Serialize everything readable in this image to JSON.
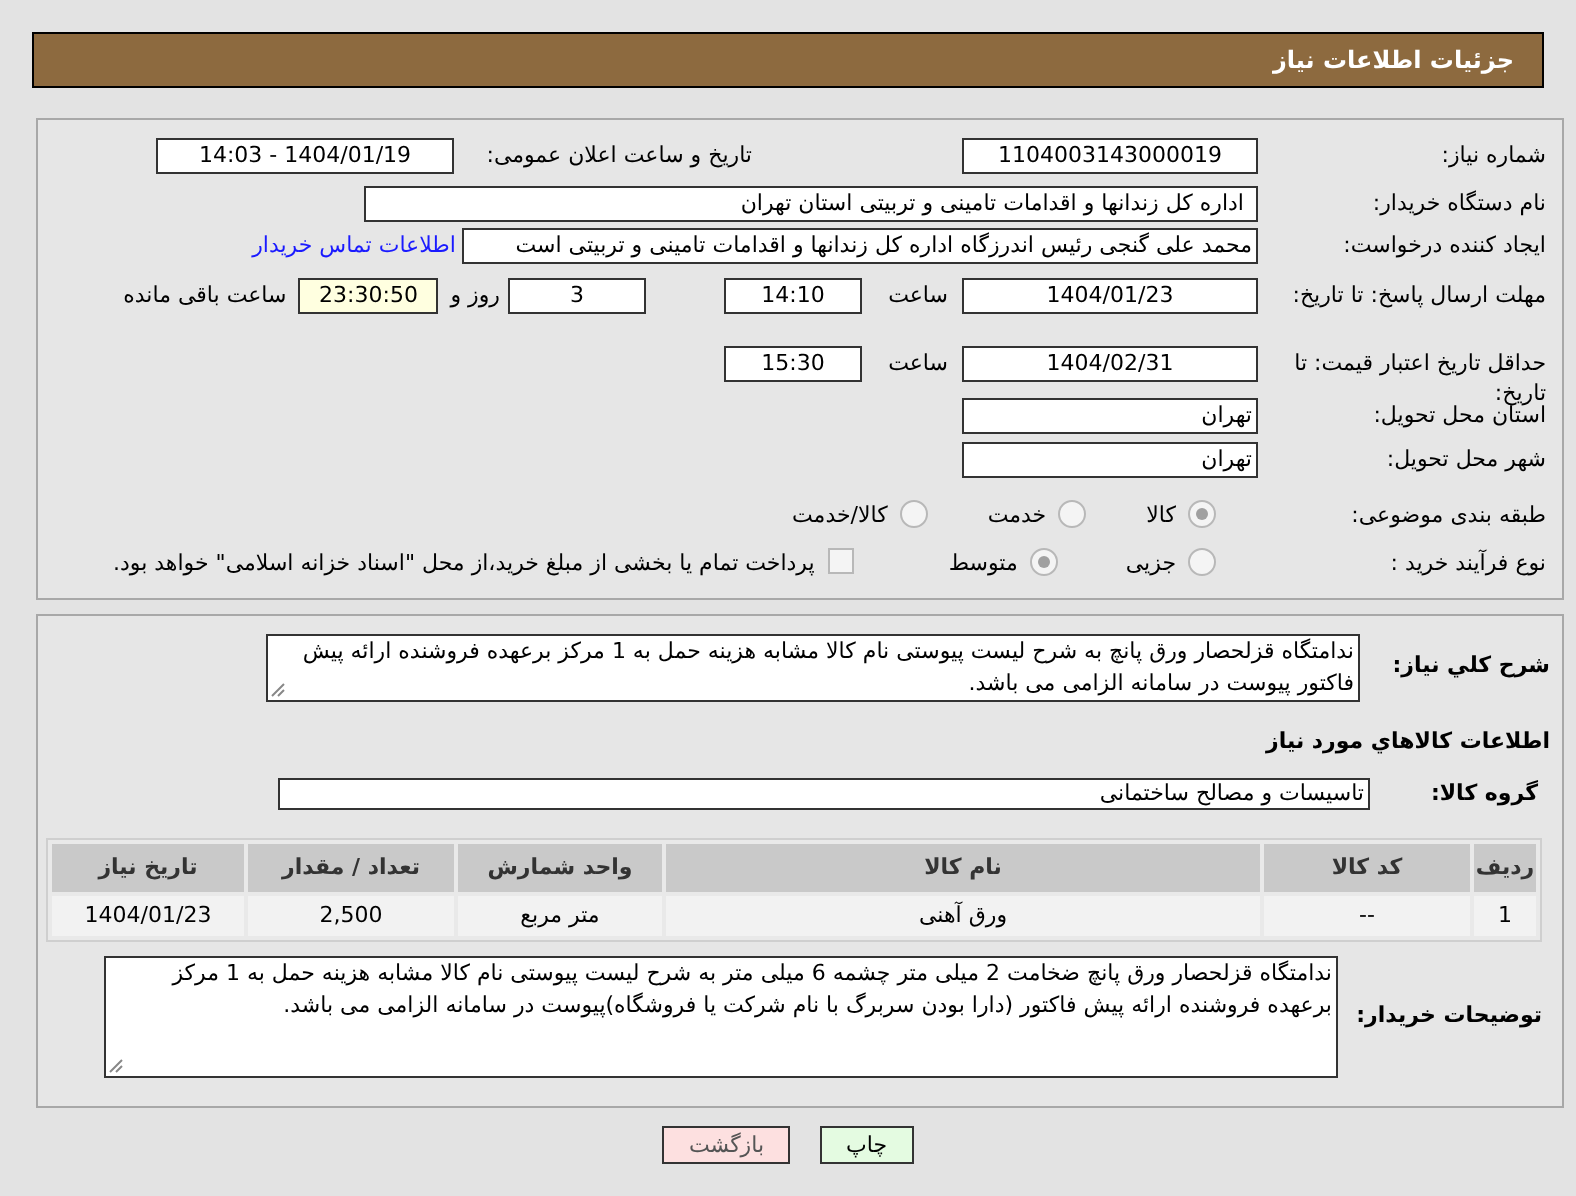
{
  "header": {
    "title": "جزئیات اطلاعات نیاز"
  },
  "need_number": {
    "label": "شماره نیاز:",
    "value": "1104003143000019"
  },
  "announce": {
    "label": "تاریخ و ساعت اعلان عمومی:",
    "value": "1404/01/19 - 14:03"
  },
  "buyer": {
    "label": "نام دستگاه خریدار:",
    "value": "اداره کل زندانها و اقدامات تامینی و تربیتی استان تهران"
  },
  "requester": {
    "label": "ایجاد کننده درخواست:",
    "value": "محمد علی گنجی رئیس اندرزگاه  اداره کل زندانها و اقدامات تامینی و تربیتی است",
    "link": "اطلاعات تماس خریدار"
  },
  "deadline": {
    "label": "مهلت ارسال پاسخ: تا تاریخ:",
    "date": "1404/01/23",
    "time_label": "ساعت",
    "time": "14:10",
    "days": "3",
    "days_label": "روز و",
    "remaining": "23:30:50",
    "remaining_label": "ساعت باقی مانده"
  },
  "validity": {
    "label": "حداقل تاریخ اعتبار قیمت: تا تاریخ:",
    "date": "1404/02/31",
    "time_label": "ساعت",
    "time": "15:30"
  },
  "province": {
    "label": "استان محل تحویل:",
    "value": "تهران"
  },
  "city": {
    "label": "شهر محل تحویل:",
    "value": "تهران"
  },
  "category": {
    "label": "طبقه بندی موضوعی:",
    "options": [
      {
        "label": "کالا",
        "selected": true
      },
      {
        "label": "خدمت",
        "selected": false
      },
      {
        "label": "کالا/خدمت",
        "selected": false
      }
    ]
  },
  "process": {
    "label": "نوع فرآیند خرید :",
    "options": [
      {
        "label": "جزیی",
        "selected": false
      },
      {
        "label": "متوسط",
        "selected": true
      }
    ],
    "treasury": {
      "label": "پرداخت تمام یا بخشی از مبلغ خرید،از محل \"اسناد خزانه اسلامی\" خواهد بود.",
      "checked": false
    }
  },
  "summary": {
    "label": "شرح كلي نياز:",
    "value": "ندامتگاه قزلحصار ورق پانچ به شرح لیست پیوستی نام کالا مشابه هزینه حمل  به 1 مرکز برعهده فروشنده ارائه پیش فاکتور پیوست در سامانه الزامی می باشد."
  },
  "goods_heading": "اطلاعات کالاهاي مورد نياز",
  "goods_group": {
    "label": "گروه کالا:",
    "value": "تاسیسات و مصالح ساختمانی"
  },
  "table": {
    "columns": [
      "ردیف",
      "کد کالا",
      "نام کالا",
      "واحد شمارش",
      "تعداد / مقدار",
      "تاریخ نیاز"
    ],
    "rows": [
      [
        "1",
        "--",
        "ورق آهنی",
        "متر مربع",
        "2,500",
        "1404/01/23"
      ]
    ]
  },
  "buyer_notes": {
    "label": "توضیحات خریدار:",
    "value": "ندامتگاه قزلحصار ورق پانچ ضخامت 2 میلی متر چشمه 6 میلی متر به شرح لیست پیوستی نام کالا مشابه هزینه حمل  به 1 مرکز برعهده فروشنده ارائه پیش فاکتور (دارا بودن سربرگ با نام شرکت یا فروشگاه)پیوست در سامانه الزامی می باشد."
  },
  "buttons": [
    {
      "label": "چاپ",
      "kind": "print"
    },
    {
      "label": "بازگشت",
      "kind": "back"
    }
  ]
}
